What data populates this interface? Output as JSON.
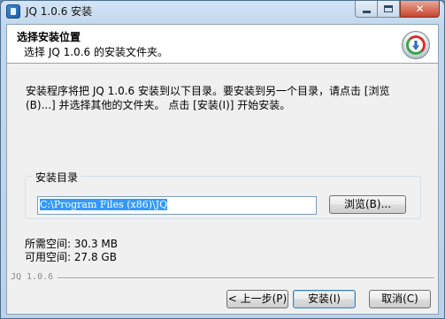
{
  "window": {
    "title": "JQ 1.0.6 安装",
    "controls": {
      "minimize": "",
      "maximize": "",
      "close": "✕"
    }
  },
  "header": {
    "title": "选择安装位置",
    "subtitle": "选择 JQ 1.0.6 的安装文件夹。",
    "logo_icon": "installer-disc-icon"
  },
  "description": "安装程序将把 JQ 1.0.6 安装到以下目录。要安装到另一个目录，请点击 [浏览(B)...] 并选择其他的文件夹。 点击 [安装(I)] 开始安装。",
  "install_dir": {
    "group_label": "安装目录",
    "path": "C:\\Program Files (x86)\\JQ",
    "browse_label": "浏览(B)..."
  },
  "space": {
    "required": "所需空间: 30.3 MB",
    "available": "可用空间: 27.8 GB"
  },
  "branding": "JQ 1.0.6",
  "footer": {
    "back_label": "< 上一步(P)",
    "install_label": "安装(I)",
    "cancel_label": "取消(C)"
  }
}
